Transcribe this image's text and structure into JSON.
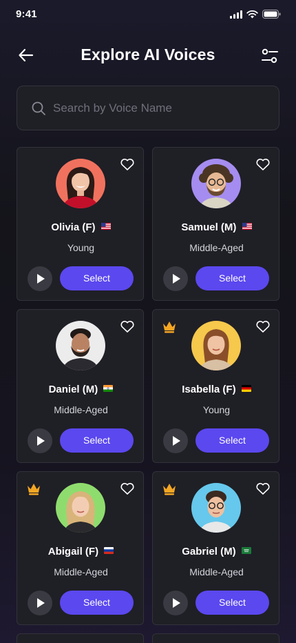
{
  "status_bar": {
    "time": "9:41"
  },
  "header": {
    "title": "Explore AI Voices",
    "back_icon": "arrow-left-icon",
    "filter_icon": "filter-sliders-icon"
  },
  "search": {
    "placeholder": "Search by Voice Name",
    "value": ""
  },
  "colors": {
    "accent": "#5b48ef",
    "card_bg": "#1f1f26",
    "crown": "#f5a623"
  },
  "voices": [
    {
      "name": "Olivia (F)",
      "flag": "US",
      "age": "Young",
      "premium": false,
      "avatar_bg": "#f0725e",
      "select_label": "Select"
    },
    {
      "name": "Samuel (M)",
      "flag": "US",
      "age": "Middle-Aged",
      "premium": false,
      "avatar_bg": "#a58cf0",
      "select_label": "Select"
    },
    {
      "name": "Daniel (M)",
      "flag": "IN",
      "age": "Middle-Aged",
      "premium": false,
      "avatar_bg": "#ececec",
      "select_label": "Select"
    },
    {
      "name": "Isabella (F)",
      "flag": "DE",
      "age": "Young",
      "premium": true,
      "avatar_bg": "#f6c84c",
      "select_label": "Select"
    },
    {
      "name": "Abigail (F)",
      "flag": "RU",
      "age": "Middle-Aged",
      "premium": true,
      "avatar_bg": "#8fdc6e",
      "select_label": "Select"
    },
    {
      "name": "Gabriel (M)",
      "flag": "SA",
      "age": "Middle-Aged",
      "premium": true,
      "avatar_bg": "#66c8ec",
      "select_label": "Select"
    }
  ]
}
